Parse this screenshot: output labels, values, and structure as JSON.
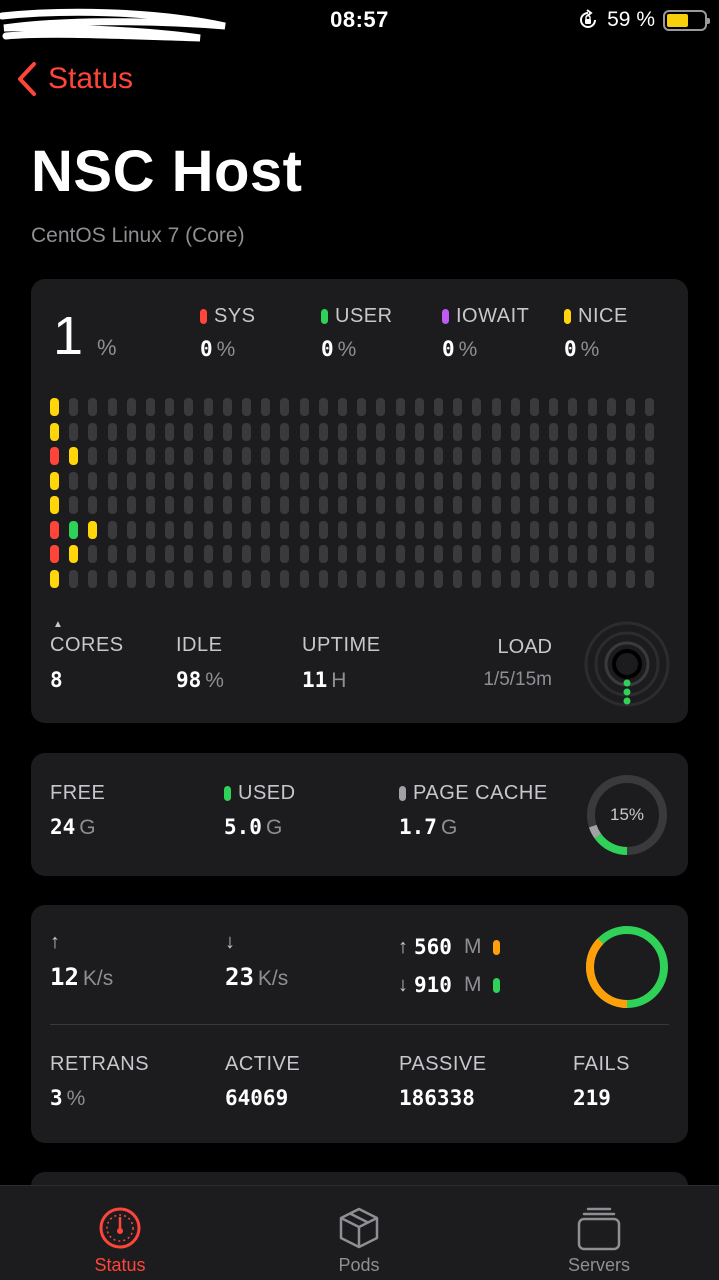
{
  "status_bar": {
    "time": "08:57",
    "battery_text": "59 %",
    "battery_level": 0.59,
    "battery_color": "#f7cf0a"
  },
  "nav": {
    "back_label": "Status",
    "title": "NSC Host",
    "subtitle": "CentOS Linux 7 (Core)"
  },
  "cpu": {
    "usage_value": "1",
    "usage_unit": "%",
    "stats": [
      {
        "label": "SYS",
        "value": "0",
        "unit": "%",
        "color": "#ff453a"
      },
      {
        "label": "USER",
        "value": "0",
        "unit": "%",
        "color": "#30d158"
      },
      {
        "label": "IOWAIT",
        "value": "0",
        "unit": "%",
        "color": "#bf5af2"
      },
      {
        "label": "NICE",
        "value": "0",
        "unit": "%",
        "color": "#ffd60a"
      }
    ],
    "grid_columns": 32,
    "grid_rows": 8,
    "grid_active": [
      {
        "col": 0,
        "row": 0,
        "color": "#ffd60a"
      },
      {
        "col": 0,
        "row": 1,
        "color": "#ffd60a"
      },
      {
        "col": 0,
        "row": 2,
        "color": "#ff453a"
      },
      {
        "col": 1,
        "row": 2,
        "color": "#ffd60a"
      },
      {
        "col": 0,
        "row": 3,
        "color": "#ffd60a"
      },
      {
        "col": 0,
        "row": 4,
        "color": "#ffd60a"
      },
      {
        "col": 0,
        "row": 5,
        "color": "#ff453a"
      },
      {
        "col": 1,
        "row": 5,
        "color": "#30d158"
      },
      {
        "col": 2,
        "row": 5,
        "color": "#ffd60a"
      },
      {
        "col": 0,
        "row": 6,
        "color": "#ff453a"
      },
      {
        "col": 1,
        "row": 6,
        "color": "#ffd60a"
      },
      {
        "col": 0,
        "row": 7,
        "color": "#ffd60a"
      }
    ],
    "cores_label": "CORES",
    "cores_value": "8",
    "idle_label": "IDLE",
    "idle_value": "98",
    "idle_unit": "%",
    "uptime_label": "UPTIME",
    "uptime_value": "11",
    "uptime_unit": "H",
    "load_label": "LOAD",
    "load_sub": "1/5/15m"
  },
  "memory": {
    "free_label": "FREE",
    "free_value": "24",
    "free_unit": "G",
    "used_label": "USED",
    "used_value": "5.0",
    "used_unit": "G",
    "used_color": "#30d158",
    "cache_label": "PAGE CACHE",
    "cache_value": "1.7",
    "cache_unit": "G",
    "cache_color": "#a1a1a6",
    "percent_text": "15%",
    "used_fraction": 0.15,
    "cache_fraction": 0.05
  },
  "network": {
    "up_arrow": "↑",
    "down_arrow": "↓",
    "up_rate": "12",
    "up_unit": "K/s",
    "down_rate": "23",
    "down_unit": "K/s",
    "total_up": "560",
    "total_up_unit": "M",
    "total_up_color": "#ff9f0a",
    "total_down": "910",
    "total_down_unit": "M",
    "total_down_color": "#30d158",
    "retrans_label": "RETRANS",
    "retrans_value": "3",
    "retrans_unit": "%",
    "active_label": "ACTIVE",
    "active_value": "64069",
    "passive_label": "PASSIVE",
    "passive_value": "186338",
    "fails_label": "FAILS",
    "fails_value": "219"
  },
  "tabs": [
    {
      "label": "Status",
      "icon": "gauge-icon",
      "active": true
    },
    {
      "label": "Pods",
      "icon": "cube-icon",
      "active": false
    },
    {
      "label": "Servers",
      "icon": "stack-icon",
      "active": false
    }
  ],
  "colors": {
    "accent": "#ff453a",
    "card_bg": "#1c1c1e",
    "inactive_cell": "#3a3a3c"
  }
}
